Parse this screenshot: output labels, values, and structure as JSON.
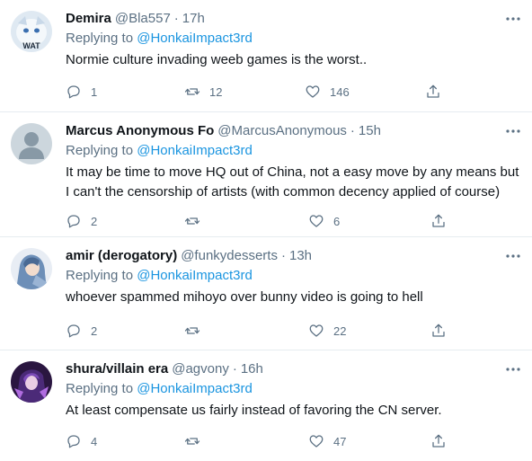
{
  "reply_prefix": "Replying to",
  "tweets": [
    {
      "name": "Demira",
      "handle": "@Bla557",
      "dot": "·",
      "time": "17h",
      "replying_to": "@HonkaiImpact3rd",
      "text": "Normie culture invading weeb games is the worst..",
      "replies": "1",
      "retweets": "12",
      "likes": "146",
      "avatar_badge": "WAT"
    },
    {
      "name": "Marcus Anonymous Fo",
      "handle": "@MarcusAnonymous",
      "dot": "·",
      "time": "15h",
      "replying_to": "@HonkaiImpact3rd",
      "text": "It may be time to move HQ out of China, not a easy move by any means but I can't the censorship of artists (with common decency applied of course)",
      "replies": "2",
      "retweets": "",
      "likes": "6"
    },
    {
      "name": "amir (derogatory)",
      "handle": "@funkydesserts",
      "dot": "·",
      "time": "13h",
      "replying_to": "@HonkaiImpact3rd",
      "text": "whoever spammed mihoyo over bunny video is going to hell",
      "replies": "2",
      "retweets": "",
      "likes": "22"
    },
    {
      "name": "shura/villain era",
      "handle": "@agvony",
      "dot": "·",
      "time": "16h",
      "replying_to": "@HonkaiImpact3rd",
      "text": "At least compensate us fairly instead of favoring the CN server.",
      "replies": "4",
      "retweets": "",
      "likes": "47"
    }
  ],
  "icons": {
    "reply": "reply-icon",
    "retweet": "retweet-icon",
    "like": "heart-icon",
    "share": "share-icon",
    "more": "more-options-icon"
  },
  "colors": {
    "text": "#0f1419",
    "muted": "#5b7083",
    "link": "#1b95e0",
    "divider": "#e6ecf0"
  }
}
